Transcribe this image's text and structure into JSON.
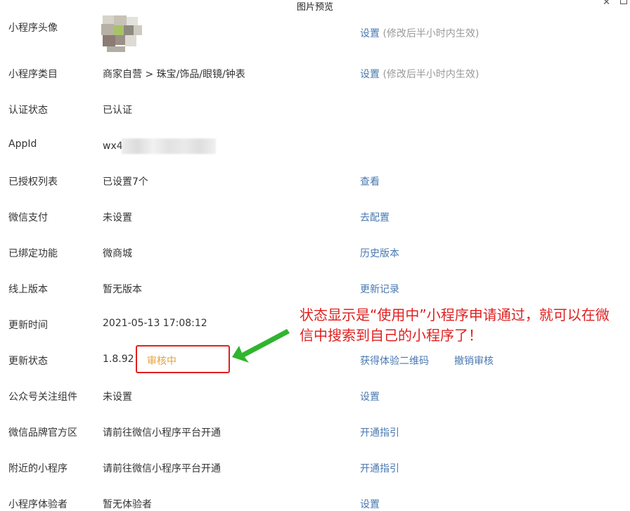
{
  "window": {
    "title": "图片预览"
  },
  "rows": {
    "avatar": {
      "label": "小程序头像",
      "action": "设置",
      "note": "(修改后半小时内生效)"
    },
    "category": {
      "label": "小程序类目",
      "value": "商家自营 > 珠宝/饰品/眼镜/钟表",
      "action": "设置",
      "note": "(修改后半小时内生效)"
    },
    "auth": {
      "label": "认证状态",
      "value": "已认证"
    },
    "appid": {
      "label": "AppId",
      "value": "wx4"
    },
    "authlist": {
      "label": "已授权列表",
      "value": "已设置7个",
      "action": "查看"
    },
    "pay": {
      "label": "微信支付",
      "value": "未设置",
      "action": "去配置"
    },
    "bound": {
      "label": "已绑定功能",
      "value": "微商城",
      "action": "历史版本"
    },
    "online": {
      "label": "线上版本",
      "value": "暂无版本",
      "action": "更新记录"
    },
    "update_time": {
      "label": "更新时间",
      "value": "2021-05-13 17:08:12"
    },
    "update_status": {
      "label": "更新状态",
      "value": "1.8.92",
      "status": "审核中",
      "action": "获得体验二维码",
      "action2": "撤销审核"
    },
    "follow": {
      "label": "公众号关注组件",
      "value": "未设置",
      "action": "设置"
    },
    "brand": {
      "label": "微信品牌官方区",
      "value": "请前往微信小程序平台开通",
      "action": "开通指引"
    },
    "nearby": {
      "label": "附近的小程序",
      "value": "请前往微信小程序平台开通",
      "action": "开通指引"
    },
    "tester": {
      "label": "小程序体验者",
      "value": "暂无体验者",
      "action": "设置"
    }
  },
  "annotation": {
    "text": "状态显示是“使用中”小程序申请通过，就可以在微信中搜索到自己的小程序了！"
  },
  "colors": {
    "link": "#4a78b0",
    "status": "#e6a23c",
    "annotation": "#e02020",
    "note": "#999999"
  }
}
